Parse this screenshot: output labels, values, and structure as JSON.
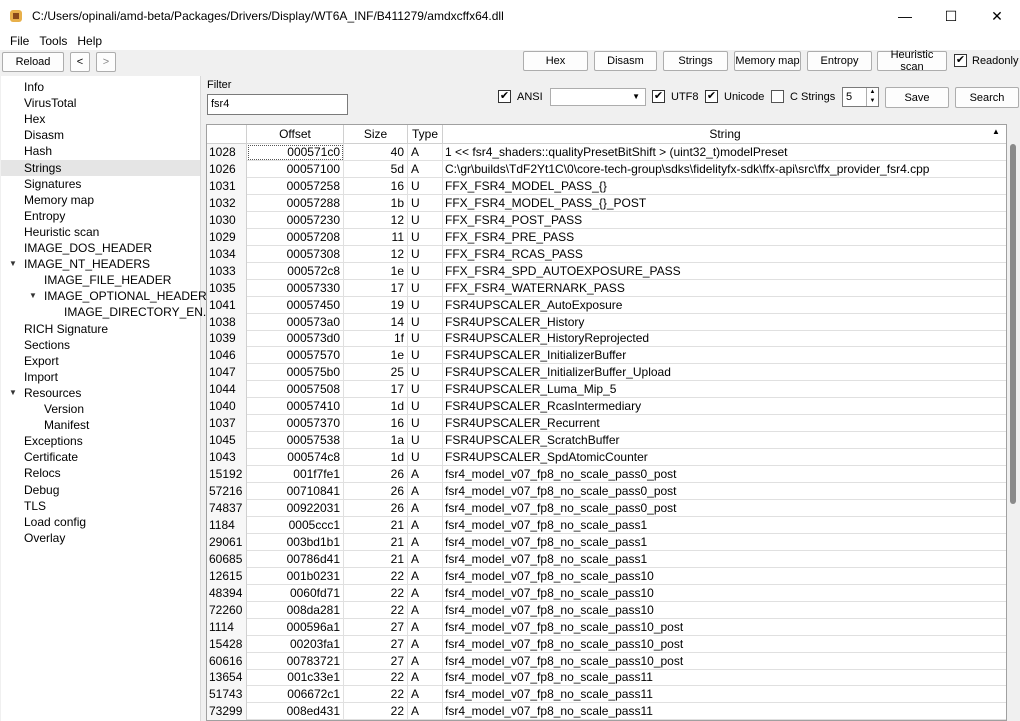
{
  "window": {
    "title": "C:/Users/opinali/amd-beta/Packages/Drivers/Display/WT6A_INF/B411279/amdxcffx64.dll",
    "minimize": "—",
    "maximize": "☐",
    "close": "✕"
  },
  "menu": [
    "File",
    "Tools",
    "Help"
  ],
  "toolbar": {
    "reload": "Reload",
    "back": "<",
    "forward": ">",
    "hex": "Hex",
    "disasm": "Disasm",
    "strings": "Strings",
    "memory_map": "Memory map",
    "entropy": "Entropy",
    "heuristic_scan": "Heuristic scan",
    "readonly_label": "Readonly",
    "readonly_checked": "✔"
  },
  "filter": {
    "label": "Filter",
    "value": "fsr4",
    "ansi_label": "ANSI",
    "ansi_check": "✔",
    "combo_value": "",
    "utf8_label": "UTF8",
    "utf8_check": "✔",
    "unicode_label": "Unicode",
    "unicode_check": "✔",
    "cstrings_label": "C Strings",
    "cstrings_check": "",
    "min_length": "5",
    "save": "Save",
    "search": "Search"
  },
  "sidebar": [
    {
      "label": "Info",
      "level": 0
    },
    {
      "label": "VirusTotal",
      "level": 0
    },
    {
      "label": "Hex",
      "level": 0
    },
    {
      "label": "Disasm",
      "level": 0
    },
    {
      "label": "Hash",
      "level": 0
    },
    {
      "label": "Strings",
      "level": 0,
      "selected": true
    },
    {
      "label": "Signatures",
      "level": 0
    },
    {
      "label": "Memory map",
      "level": 0
    },
    {
      "label": "Entropy",
      "level": 0
    },
    {
      "label": "Heuristic scan",
      "level": 0
    },
    {
      "label": "IMAGE_DOS_HEADER",
      "level": 0
    },
    {
      "label": "IMAGE_NT_HEADERS",
      "level": 0,
      "expanded": true
    },
    {
      "label": "IMAGE_FILE_HEADER",
      "level": 1
    },
    {
      "label": "IMAGE_OPTIONAL_HEADER",
      "level": 1,
      "expanded": true
    },
    {
      "label": "IMAGE_DIRECTORY_EN...",
      "level": 2
    },
    {
      "label": "RICH Signature",
      "level": 0
    },
    {
      "label": "Sections",
      "level": 0
    },
    {
      "label": "Export",
      "level": 0
    },
    {
      "label": "Import",
      "level": 0
    },
    {
      "label": "Resources",
      "level": 0,
      "expanded": true
    },
    {
      "label": "Version",
      "level": 1
    },
    {
      "label": "Manifest",
      "level": 1
    },
    {
      "label": "Exceptions",
      "level": 0
    },
    {
      "label": "Certificate",
      "level": 0
    },
    {
      "label": "Relocs",
      "level": 0
    },
    {
      "label": "Debug",
      "level": 0
    },
    {
      "label": "TLS",
      "level": 0
    },
    {
      "label": "Load config",
      "level": 0
    },
    {
      "label": "Overlay",
      "level": 0
    }
  ],
  "table": {
    "columns": [
      "Offset",
      "Size",
      "Type",
      "String"
    ],
    "sort_indicator": "▲",
    "rows": [
      [
        "1028",
        "000571c0",
        "40",
        "A",
        "1 << fsr4_shaders::qualityPresetBitShift > (uint32_t)modelPreset"
      ],
      [
        "1026",
        "00057100",
        "5d",
        "A",
        "C:\\gr\\builds\\TdF2Yt1C\\0\\core-tech-group\\sdks\\fidelityfx-sdk\\ffx-api\\src\\ffx_provider_fsr4.cpp"
      ],
      [
        "1031",
        "00057258",
        "16",
        "U",
        "FFX_FSR4_MODEL_PASS_{}"
      ],
      [
        "1032",
        "00057288",
        "1b",
        "U",
        "FFX_FSR4_MODEL_PASS_{}_POST"
      ],
      [
        "1030",
        "00057230",
        "12",
        "U",
        "FFX_FSR4_POST_PASS"
      ],
      [
        "1029",
        "00057208",
        "11",
        "U",
        "FFX_FSR4_PRE_PASS"
      ],
      [
        "1034",
        "00057308",
        "12",
        "U",
        "FFX_FSR4_RCAS_PASS"
      ],
      [
        "1033",
        "000572c8",
        "1e",
        "U",
        "FFX_FSR4_SPD_AUTOEXPOSURE_PASS"
      ],
      [
        "1035",
        "00057330",
        "17",
        "U",
        "FFX_FSR4_WATERNARK_PASS"
      ],
      [
        "1041",
        "00057450",
        "19",
        "U",
        "FSR4UPSCALER_AutoExposure"
      ],
      [
        "1038",
        "000573a0",
        "14",
        "U",
        "FSR4UPSCALER_History"
      ],
      [
        "1039",
        "000573d0",
        "1f",
        "U",
        "FSR4UPSCALER_HistoryReprojected"
      ],
      [
        "1046",
        "00057570",
        "1e",
        "U",
        "FSR4UPSCALER_InitializerBuffer"
      ],
      [
        "1047",
        "000575b0",
        "25",
        "U",
        "FSR4UPSCALER_InitializerBuffer_Upload"
      ],
      [
        "1044",
        "00057508",
        "17",
        "U",
        "FSR4UPSCALER_Luma_Mip_5"
      ],
      [
        "1040",
        "00057410",
        "1d",
        "U",
        "FSR4UPSCALER_RcasIntermediary"
      ],
      [
        "1037",
        "00057370",
        "16",
        "U",
        "FSR4UPSCALER_Recurrent"
      ],
      [
        "1045",
        "00057538",
        "1a",
        "U",
        "FSR4UPSCALER_ScratchBuffer"
      ],
      [
        "1043",
        "000574c8",
        "1d",
        "U",
        "FSR4UPSCALER_SpdAtomicCounter"
      ],
      [
        "15192",
        "001f7fe1",
        "26",
        "A",
        "fsr4_model_v07_fp8_no_scale_pass0_post"
      ],
      [
        "57216",
        "00710841",
        "26",
        "A",
        "fsr4_model_v07_fp8_no_scale_pass0_post"
      ],
      [
        "74837",
        "00922031",
        "26",
        "A",
        "fsr4_model_v07_fp8_no_scale_pass0_post"
      ],
      [
        "1184",
        "0005ccc1",
        "21",
        "A",
        "fsr4_model_v07_fp8_no_scale_pass1"
      ],
      [
        "29061",
        "003bd1b1",
        "21",
        "A",
        "fsr4_model_v07_fp8_no_scale_pass1"
      ],
      [
        "60685",
        "00786d41",
        "21",
        "A",
        "fsr4_model_v07_fp8_no_scale_pass1"
      ],
      [
        "12615",
        "001b0231",
        "22",
        "A",
        "fsr4_model_v07_fp8_no_scale_pass10"
      ],
      [
        "48394",
        "0060fd71",
        "22",
        "A",
        "fsr4_model_v07_fp8_no_scale_pass10"
      ],
      [
        "72260",
        "008da281",
        "22",
        "A",
        "fsr4_model_v07_fp8_no_scale_pass10"
      ],
      [
        "1114",
        "000596a1",
        "27",
        "A",
        "fsr4_model_v07_fp8_no_scale_pass10_post"
      ],
      [
        "15428",
        "00203fa1",
        "27",
        "A",
        "fsr4_model_v07_fp8_no_scale_pass10_post"
      ],
      [
        "60616",
        "00783721",
        "27",
        "A",
        "fsr4_model_v07_fp8_no_scale_pass10_post"
      ],
      [
        "13654",
        "001c33e1",
        "22",
        "A",
        "fsr4_model_v07_fp8_no_scale_pass11"
      ],
      [
        "51743",
        "006672c1",
        "22",
        "A",
        "fsr4_model_v07_fp8_no_scale_pass11"
      ],
      [
        "73299",
        "008ed431",
        "22",
        "A",
        "fsr4_model_v07_fp8_no_scale_pass11"
      ]
    ]
  }
}
